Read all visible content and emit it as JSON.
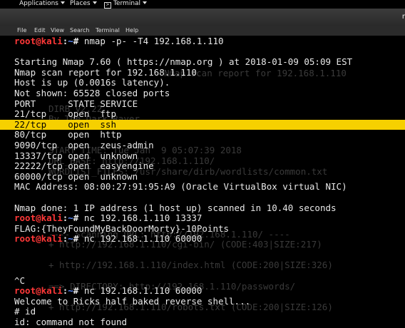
{
  "topbar": {
    "applications": "Applications",
    "places": "Places",
    "terminal": "Terminal"
  },
  "menubar": [
    "File",
    "Edit",
    "View",
    "Search",
    "Terminal",
    "Help"
  ],
  "titlebar": {
    "glyph": "r"
  },
  "prompt": {
    "user": "root@kali",
    "path": "~",
    "symbol": "#"
  },
  "terminal": {
    "cmd1": "nmap -p- -T4 192.168.1.110",
    "scan_start": "Starting Nmap 7.60 ( https://nmap.org ) at 2018-01-09 05:09 EST",
    "scan_report": "Nmap scan report for 192.168.1.110",
    "host_up": "Host is up (0.0016s latency).",
    "not_shown": "Not shown: 65528 closed ports",
    "port_header": "PORT      STATE SERVICE",
    "ports": [
      "21/tcp    open  ftp",
      "22/tcp    open  ssh",
      "80/tcp    open  http",
      "9090/tcp  open  zeus-admin",
      "13337/tcp open  unknown",
      "22222/tcp open  easyengine",
      "60000/tcp open  unknown"
    ],
    "mac": "MAC Address: 08:00:27:91:95:A9 (Oracle VirtualBox virtual NIC)",
    "done": "Nmap done: 1 IP address (1 host up) scanned in 10.40 seconds",
    "cmd2": "nc 192.168.1.110 13337",
    "flag": "FLAG:{TheyFoundMyBackDoorMorty}-10Points",
    "cmd3": "nc 192.168.1.110 60000",
    "ctrl_c": "^C",
    "cmd4": "nc 192.168.1.110 60000",
    "welcome": "Welcome to Ricks half baked reverse shell...",
    "shell_prompt": "# id",
    "id_result": "id: command not found"
  },
  "ghost": [
    "Nmap scan report for 192.168.1.110",
    "DIRB v2.22",
    "By The Dark Raver",
    "START_TIME: Tue Jan  9 05:07:39 2018",
    "URL_BASE: http://192.168.1.110/",
    "WORDLIST_FILES: /usr/share/dirb/wordlists/common.txt",
    "---- Scanning URL: http://192.168.1.110/ ----",
    "+ http://192.168.1.110/cgi-bin/ (CODE:403|SIZE:217)",
    "+ http://192.168.1.110/index.html (CODE:200|SIZE:326)",
    "==> DIRECTORY: http://192.168.1.110/passwords/",
    "+ http://192.168.1.110/robots.txt (CODE:200|SIZE:126)"
  ]
}
